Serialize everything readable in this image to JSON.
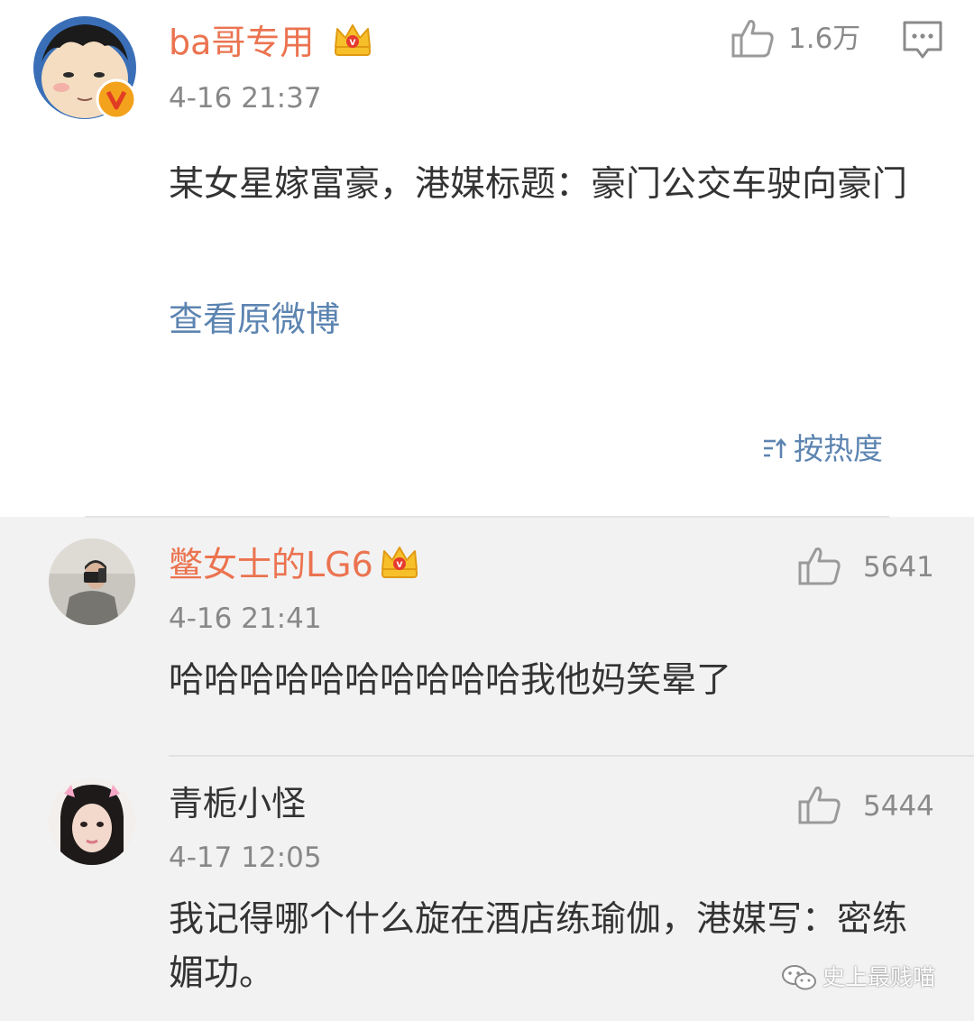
{
  "original_post": {
    "username": "ba哥专用",
    "time": "4-16 21:37",
    "like_count": "1.6万",
    "text": "某女星嫁富豪，港媒标题：豪门公交车驶向豪门",
    "view_original": "查看原微博",
    "icons": [
      "crown-badge-icon",
      "verified-v-icon",
      "thumbs-up-icon",
      "comment-icon"
    ]
  },
  "sort": {
    "label": "按热度",
    "icon": "sort-icon"
  },
  "comments": [
    {
      "username": "鳖女士的LG6",
      "time": "4-16 21:41",
      "like_count": "5641",
      "text": "哈哈哈哈哈哈哈哈哈哈我他妈笑晕了",
      "badge": "crown-badge-icon"
    },
    {
      "username": "青栀小怪",
      "time": "4-17 12:05",
      "like_count": "5444",
      "text": "我记得哪个什么旋在酒店练瑜伽，港媒写：密练媚功。"
    }
  ],
  "watermark": {
    "text": "史上最贱喵",
    "icon": "wechat-icon"
  },
  "colors": {
    "username": "#eb7350",
    "link": "#5c84b1",
    "time": "#888888",
    "background_lower": "#f2f2f2"
  }
}
